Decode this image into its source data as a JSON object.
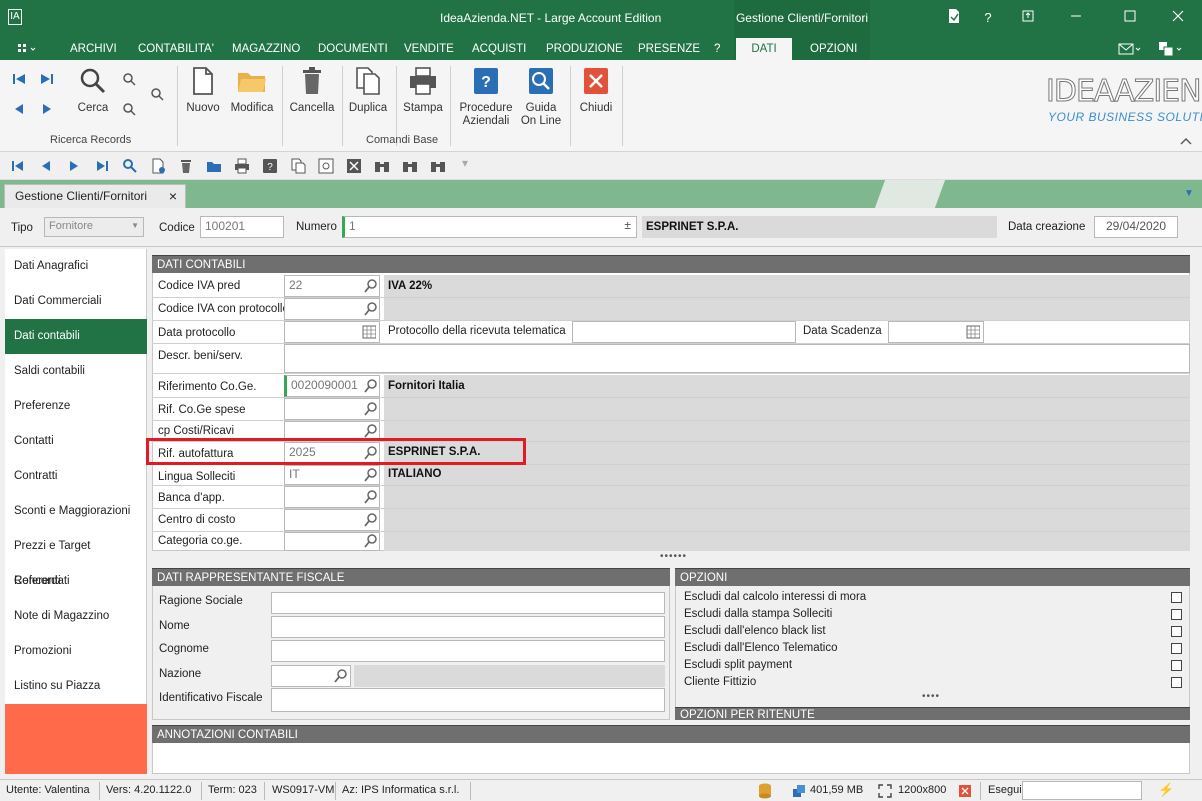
{
  "window": {
    "title": "IdeaAzienda.NET - Large Account Edition",
    "context_tab": "Gestione Clienti/Fornitori",
    "app_icon": "IA"
  },
  "menu": {
    "items": [
      "ARCHIVI",
      "CONTABILITA'",
      "MAGAZZINO",
      "DOCUMENTI",
      "VENDITE",
      "ACQUISTI",
      "PRODUZIONE",
      "PRESENZE",
      "?",
      "DATI",
      "OPZIONI"
    ],
    "active": "DATI"
  },
  "ribbon": {
    "cerca": "Cerca",
    "ricerca_label": "Ricerca Records",
    "nuovo": "Nuovo",
    "modifica": "Modifica",
    "cancella": "Cancella",
    "duplica": "Duplica",
    "stampa": "Stampa",
    "procedure_l1": "Procedure",
    "procedure_l2": "Aziendali",
    "guida_l1": "Guida",
    "guida_l2": "On Line",
    "chiudi": "Chiudi",
    "comandi_label": "Comandi Base",
    "logo_l1": "IDEAAZIENDA",
    "logo_l2": "YOUR BUSINESS SOLUTION"
  },
  "doc_tab": {
    "label": "Gestione Clienti/Fornitori",
    "close": "×"
  },
  "header": {
    "tipo_label": "Tipo",
    "tipo_value": "Fornitore",
    "codice_label": "Codice",
    "codice_value": "100201",
    "numero_label": "Numero",
    "numero_value": "1",
    "ragione": "ESPRINET S.P.A.",
    "data_label": "Data creazione",
    "data_value": "29/04/2020"
  },
  "nav": {
    "items": [
      "Dati Anagrafici",
      "Dati Commerciali",
      "Dati contabili",
      "Saldi contabili",
      "Preferenze",
      "Contatti",
      "Contratti",
      "Sconti e Maggiorazioni",
      "Prezzi e Target Concordati",
      "Referenti",
      "Note di Magazzino",
      "Promozioni",
      "Listino su Piazza"
    ],
    "active": "Dati contabili"
  },
  "dati_contabili": {
    "title": "DATI CONTABILI",
    "codice_iva_label": "Codice IVA pred",
    "codice_iva_value": "22",
    "codice_iva_desc": "IVA 22%",
    "codice_iva_prot_label": "Codice IVA con protocollo",
    "data_protocollo_label": "Data protocollo",
    "protocollo_label": "Protocollo della ricevuta telematica",
    "data_scadenza_label": "Data Scadenza",
    "descr_label": "Descr. beni/serv.",
    "rif_coge_label": "Riferimento Co.Ge.",
    "rif_coge_value": "0020090001",
    "rif_coge_desc": "Fornitori Italia",
    "rif_spese_label": "Rif. Co.Ge spese",
    "cp_costi_label": "cp Costi/Ricavi",
    "rif_autofattura_label": "Rif. autofattura",
    "rif_autofattura_value": "2025",
    "rif_autofattura_desc": "ESPRINET S.P.A.",
    "lingua_label": "Lingua Solleciti",
    "lingua_value": "IT",
    "lingua_desc": "ITALIANO",
    "banca_label": "Banca d'app.",
    "centro_label": "Centro di costo",
    "categoria_label": "Categoria co.ge."
  },
  "rappresentante": {
    "title": "DATI RAPPRESENTANTE FISCALE",
    "ragione_label": "Ragione Sociale",
    "nome_label": "Nome",
    "cognome_label": "Cognome",
    "nazione_label": "Nazione",
    "id_fiscale_label": "Identificativo Fiscale"
  },
  "opzioni": {
    "title": "OPZIONI",
    "items": [
      "Escludi dal calcolo interessi di mora",
      "Escludi dalla stampa Solleciti",
      "Escludi dall'elenco black list",
      "Escludi dall'Elenco Telematico",
      "Escludi split payment",
      "Cliente Fittizio"
    ],
    "ritenute_title": "OPZIONI PER RITENUTE"
  },
  "annotazioni": {
    "title": "ANNOTAZIONI CONTABILI"
  },
  "status": {
    "utente": "Utente: Valentina",
    "vers": "Vers: 4.20.1122.0",
    "term": "Term: 023",
    "ws": "WS0917-VM",
    "az": "Az: IPS Informatica s.r.l.",
    "memory": "401,59 MB",
    "resolution": "1200x800",
    "esegui": "Esegui"
  },
  "colors": {
    "accent": "#217346",
    "highlight": "#e01b24",
    "nav_filler": "#ff6b4a"
  }
}
